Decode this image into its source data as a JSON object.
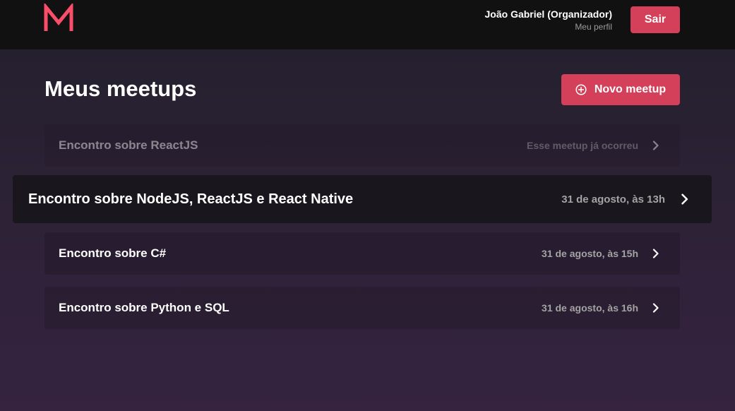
{
  "header": {
    "logo_letter": "M",
    "user_name": "João Gabriel (Organizador)",
    "profile_link": "Meu perfil",
    "logout_label": "Sair",
    "brand_color": "#d44059"
  },
  "main": {
    "title": "Meus meetups",
    "new_button_label": "Novo meetup",
    "new_button_icon": "plus-circle-icon",
    "meetups": [
      {
        "title": "Encontro sobre ReactJS",
        "date": "Esse meetup já ocorreu",
        "status": "past"
      },
      {
        "title": "Encontro sobre NodeJS, ReactJS e React Native",
        "date": "31 de agosto, às 13h",
        "status": "hovered"
      },
      {
        "title": "Encontro sobre C#",
        "date": "31 de agosto, às 15h",
        "status": "upcoming"
      },
      {
        "title": "Encontro sobre Python e SQL",
        "date": "31 de agosto, às 16h",
        "status": "upcoming"
      }
    ],
    "row_icon": "chevron-right-icon"
  }
}
